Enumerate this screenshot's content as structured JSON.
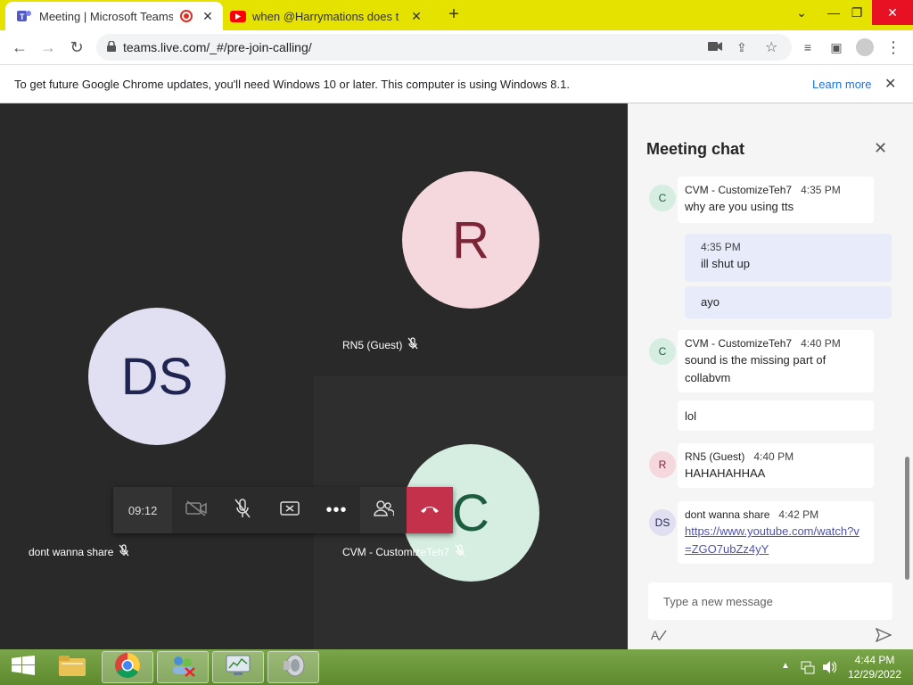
{
  "browser": {
    "tabs": [
      {
        "title": "Meeting | Microsoft Teams"
      },
      {
        "title": "when @Harrymations does the c"
      }
    ],
    "url": "teams.live.com/_#/pre-join-calling/"
  },
  "infobar": {
    "message": "To get future Google Chrome updates, you'll need Windows 10 or later. This computer is using Windows 8.1.",
    "learn_more": "Learn more"
  },
  "participants": {
    "ds": {
      "initials": "DS",
      "name": "dont wanna share"
    },
    "r": {
      "initials": "R",
      "name": "RN5 (Guest)"
    },
    "c": {
      "initials": "C",
      "name": "CVM - CustomizeTeh7"
    }
  },
  "controls": {
    "timer": "09:12"
  },
  "chat": {
    "title": "Meeting chat",
    "messages": [
      {
        "initials": "C",
        "sender": "CVM - CustomizeTeh7",
        "time": "4:35 PM",
        "text": "why are you using tts"
      },
      {
        "time": "4:35 PM",
        "text": "ill shut up"
      },
      {
        "text": "ayo"
      },
      {
        "initials": "C",
        "sender": "CVM - CustomizeTeh7",
        "time": "4:40 PM",
        "text": "sound is the missing part of collabvm"
      },
      {
        "text": "lol"
      },
      {
        "initials": "R",
        "sender": "RN5 (Guest)",
        "time": "4:40 PM",
        "text": "HAHAHAHHAA"
      },
      {
        "initials": "DS",
        "sender": "dont wanna share",
        "time": "4:42 PM",
        "text": "https://www.youtube.com/watch?v=ZGO7ubZz4yY"
      }
    ],
    "composer_placeholder": "Type a new message"
  },
  "taskbar": {
    "time": "4:44 PM",
    "date": "12/29/2022"
  },
  "colors": {
    "tabbar": "#e6e200",
    "hangup": "#c4314b",
    "taskbar": "#6b9a3a"
  }
}
